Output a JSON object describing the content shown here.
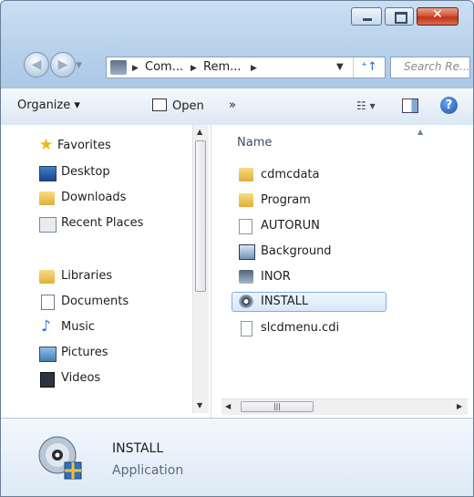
{
  "address": {
    "crumbs": [
      "Com...",
      "Rem..."
    ],
    "search_placeholder": "Search Re..."
  },
  "toolbar": {
    "organize_label": "Organize ▾",
    "open_label": "Open",
    "more_label": "»"
  },
  "nav": {
    "favorites_label": "Favorites",
    "favorites": [
      "Desktop",
      "Downloads",
      "Recent Places"
    ],
    "libraries_label": "Libraries",
    "libraries": [
      "Documents",
      "Music",
      "Pictures",
      "Videos"
    ]
  },
  "files": {
    "column_name": "Name",
    "items": [
      "cdmcdata",
      "Program",
      "AUTORUN",
      "Background",
      "INOR",
      "INSTALL",
      "slcdmenu.cdi"
    ],
    "selected": "INSTALL"
  },
  "details": {
    "name": "INSTALL",
    "type": "Application"
  },
  "icons": {
    "favorites": "star-icon",
    "libraries": "library-icon",
    "folder": "folder-icon",
    "help": "help-icon"
  },
  "colors": {
    "selection_border": "#84acdd",
    "close_button": "#c0341a",
    "folder": "#e0ae3c"
  }
}
